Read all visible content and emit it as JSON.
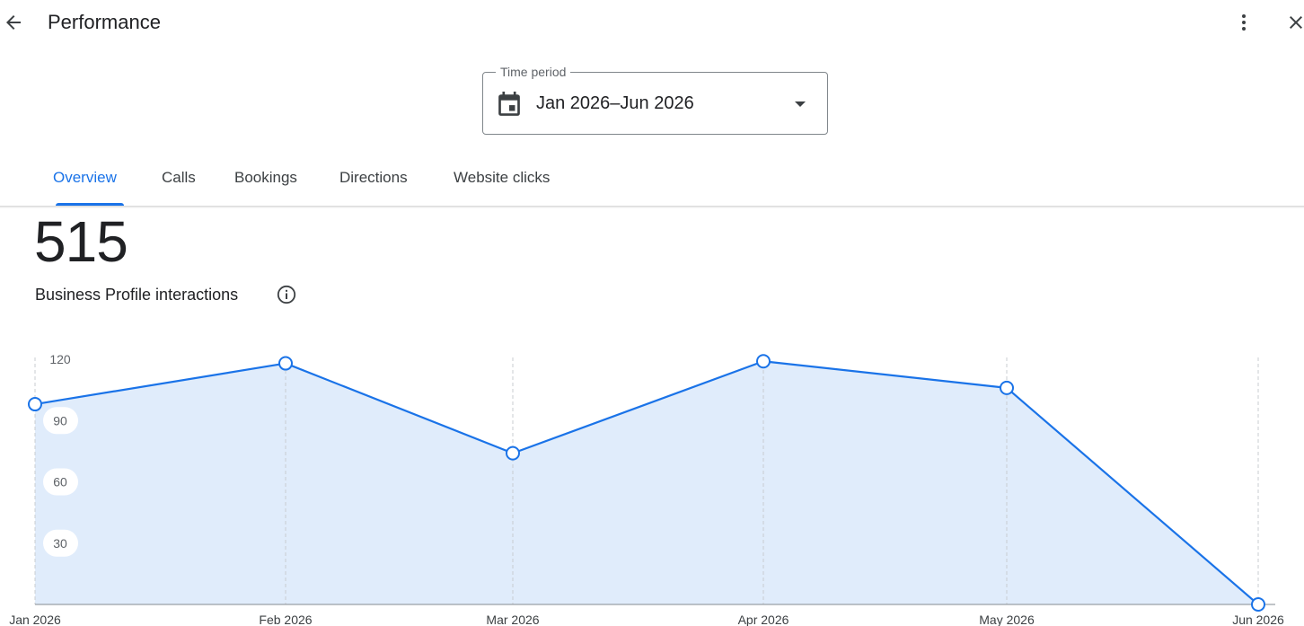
{
  "header": {
    "title": "Performance",
    "back_icon": "arrow-back-icon",
    "more_icon": "more-vert-icon",
    "close_icon": "close-icon"
  },
  "time_period": {
    "label": "Time period",
    "value": "Jan 2026–Jun 2026",
    "icon": "calendar-icon",
    "dropdown_icon": "arrow-drop-down-icon"
  },
  "tabs": [
    {
      "label": "Overview",
      "active": true
    },
    {
      "label": "Calls",
      "active": false
    },
    {
      "label": "Bookings",
      "active": false
    },
    {
      "label": "Directions",
      "active": false
    },
    {
      "label": "Website clicks",
      "active": false
    }
  ],
  "summary": {
    "total": "515",
    "label": "Business Profile interactions",
    "info_icon": "info-icon"
  },
  "colors": {
    "accent": "#1a73e8",
    "area_fill": "#e0ecfb",
    "text": "#202124",
    "muted": "#5f6368"
  },
  "chart_data": {
    "type": "area",
    "categories": [
      "Jan 2026",
      "Feb 2026",
      "Mar 2026",
      "Apr 2026",
      "May 2026",
      "Jun 2026"
    ],
    "series": [
      {
        "values": [
          98,
          118,
          74,
          119,
          106,
          0
        ]
      }
    ],
    "y_ticks": [
      "30",
      "60",
      "90",
      "120"
    ],
    "ylim": [
      0,
      120
    ],
    "grid": "vertical-dashed"
  }
}
